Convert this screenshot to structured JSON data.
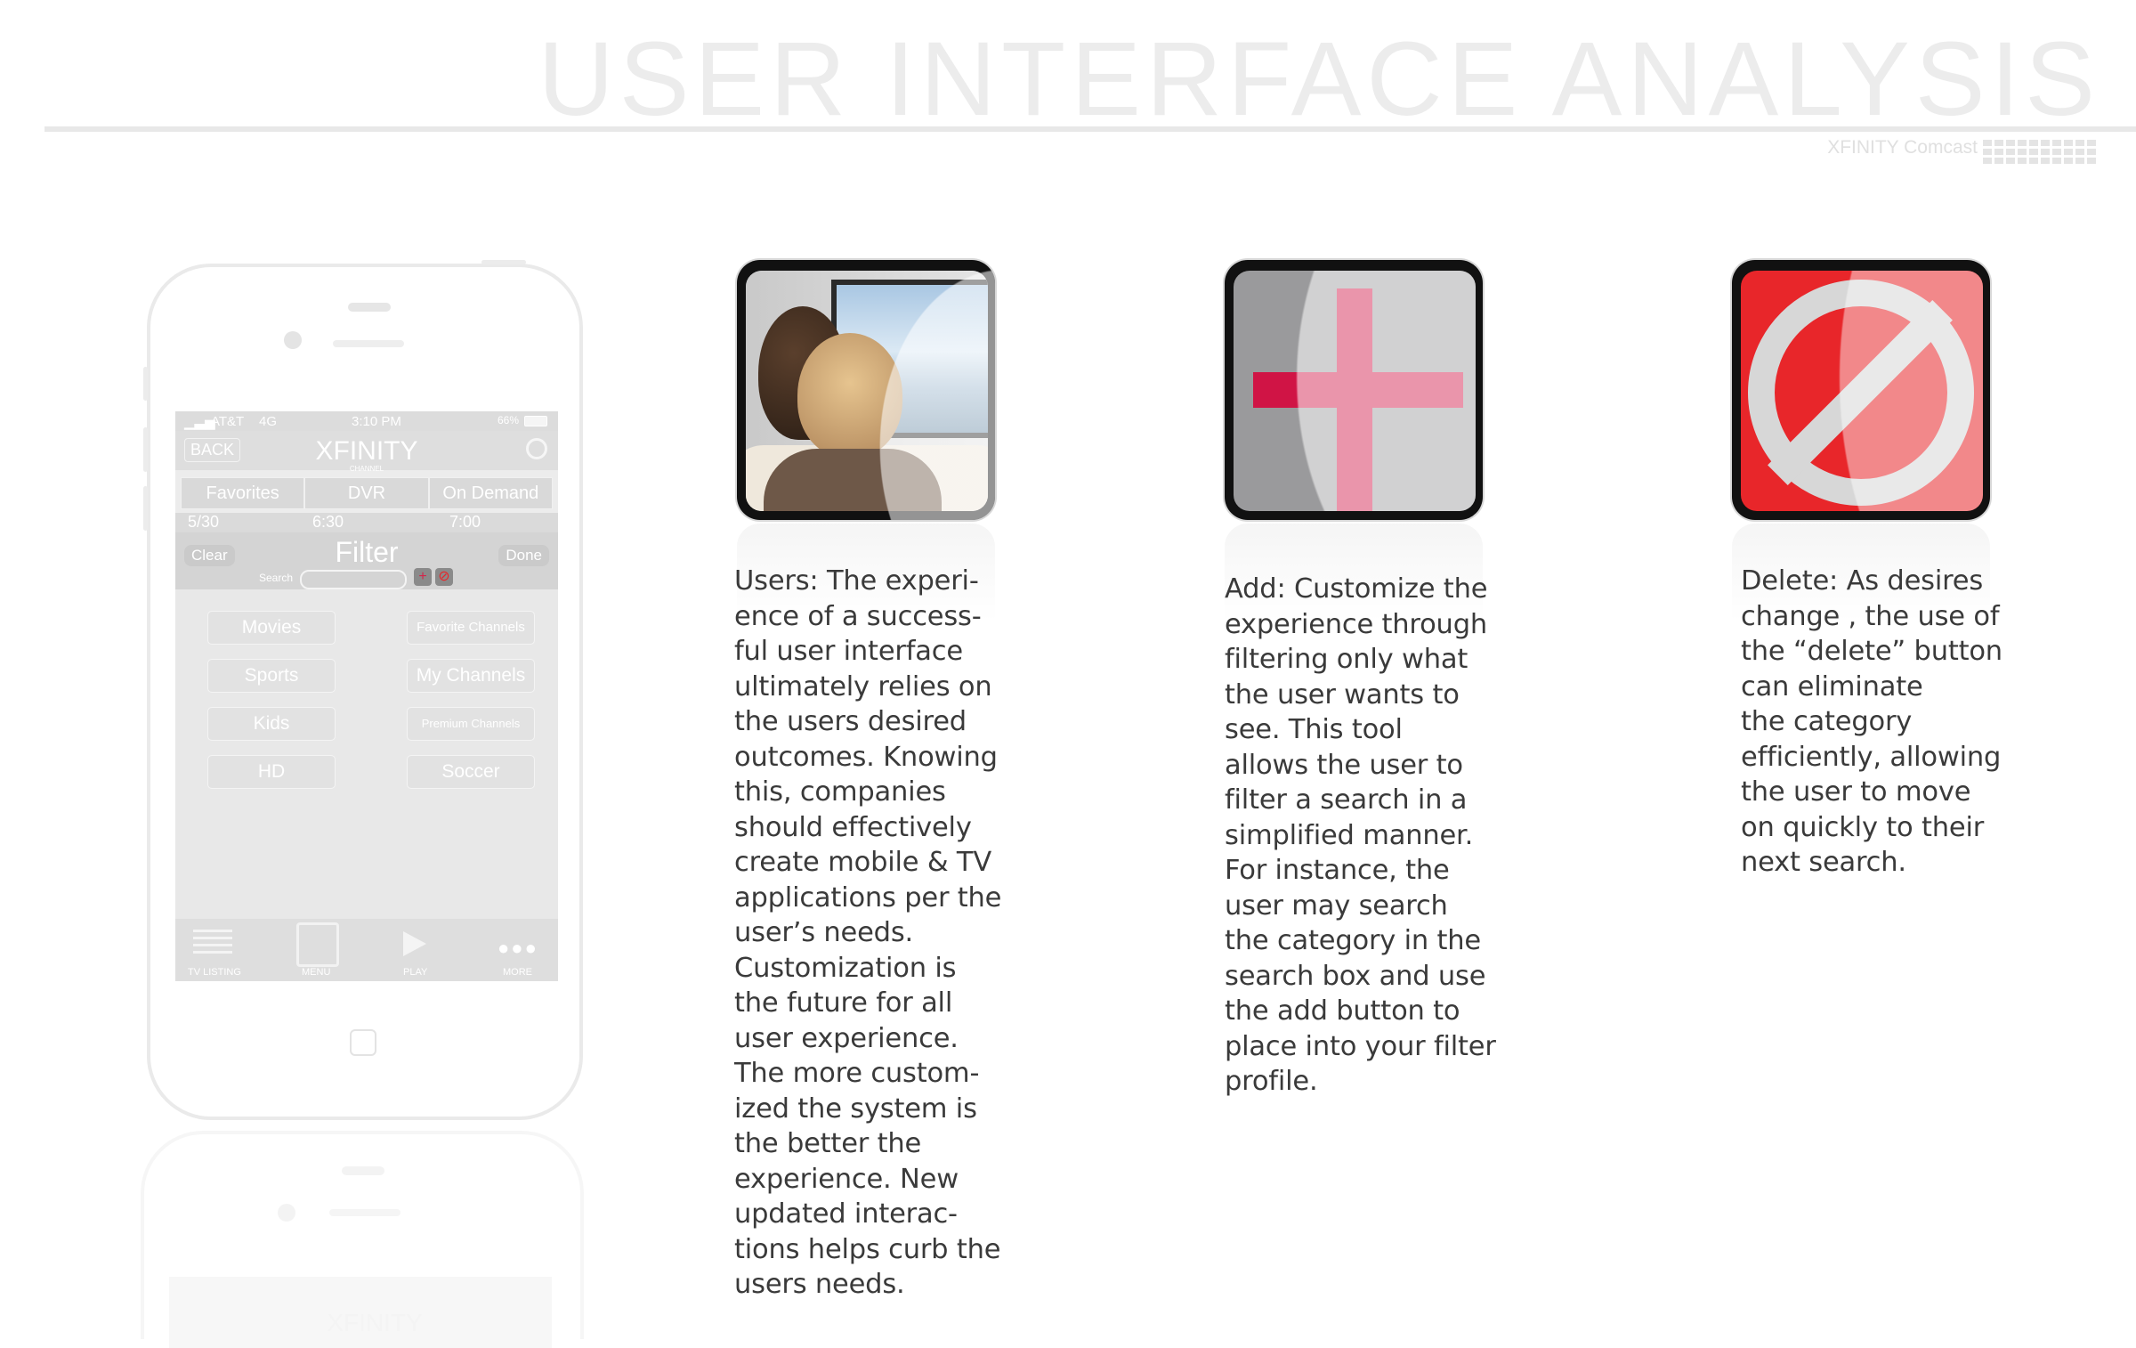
{
  "header": {
    "title": "USER INTERFACE ANALYSIS",
    "subtitle": "XFINITY Comcast"
  },
  "phone": {
    "status": {
      "carrier": "AT&T",
      "network": "4G",
      "time": "3:10 PM",
      "battery": "66%"
    },
    "nav": {
      "back": "BACK",
      "logo": "XFINITY",
      "logo_sub": "CHANNEL"
    },
    "tabs": [
      "Favorites",
      "DVR",
      "On Demand"
    ],
    "times": [
      "5/30",
      "6:30",
      "7:00"
    ],
    "filter_bar": {
      "clear": "Clear",
      "title": "Filter",
      "done": "Done",
      "search_label": "Search"
    },
    "categories_left": [
      "Movies",
      "Sports",
      "Kids",
      "HD"
    ],
    "categories_right": [
      "Favorite Channels",
      "My Channels",
      "Premium Channels",
      "Soccer"
    ],
    "tabbar": [
      "TV LISTING",
      "MENU",
      "PLAY",
      "MORE"
    ],
    "reflection_logo": "XFINITY"
  },
  "cards": {
    "users": {
      "icon": "couple-watching-tv-photo"
    },
    "add": {
      "icon": "plus-icon",
      "accent": "#d01445"
    },
    "delete": {
      "icon": "prohibited-icon",
      "accent": "#e8262a"
    }
  },
  "columns": {
    "users": "Users: The experi-\nence of a success-\nful user interface\nultimately relies on\nthe users desired\noutcomes. Knowing\nthis, companies\nshould effectively\ncreate mobile & TV\napplications per the\nuser’s needs.\nCustomization is\nthe future for all\nuser experience.\nThe more custom-\nized the system is\nthe better the\nexperience. New\nupdated interac-\ntions helps curb the\nusers needs.",
    "add": "Add: Customize the\nexperience through\nfiltering only what\nthe user wants to\nsee. This tool\nallows the user to\nfilter a search in a\nsimplified manner.\nFor instance, the\nuser may search\nthe category in the\nsearch box and use\nthe add button to\nplace into your filter\nprofile.",
    "delete": "Delete: As desires\nchange , the use of\nthe “delete” button\ncan      eliminate\nthe category\nefficiently, allowing\nthe user to move\non quickly to their\nnext search."
  }
}
